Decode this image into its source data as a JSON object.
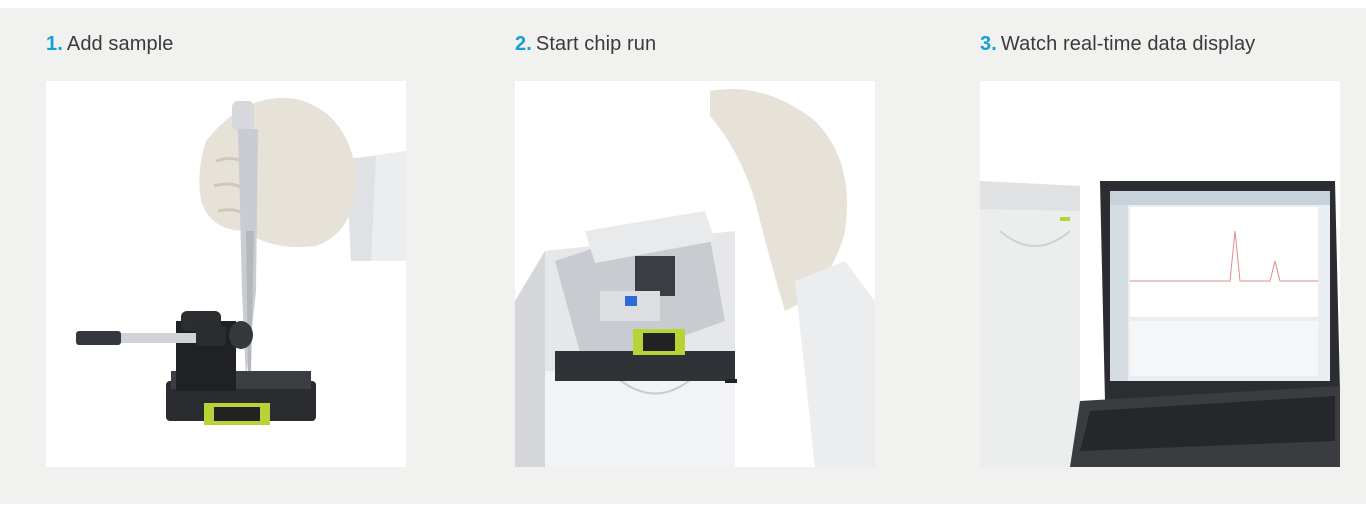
{
  "steps": [
    {
      "number": "1.",
      "label": "Add sample",
      "image": "pipette-chip-priming-photo"
    },
    {
      "number": "2.",
      "label": "Start chip run",
      "image": "bioanalyzer-lid-photo"
    },
    {
      "number": "3.",
      "label": "Watch real-time data display",
      "image": "laptop-software-photo"
    }
  ],
  "colors": {
    "accent": "#12a0d7",
    "panel_bg": "#f1f1ef",
    "chip_green": "#b7d336"
  }
}
